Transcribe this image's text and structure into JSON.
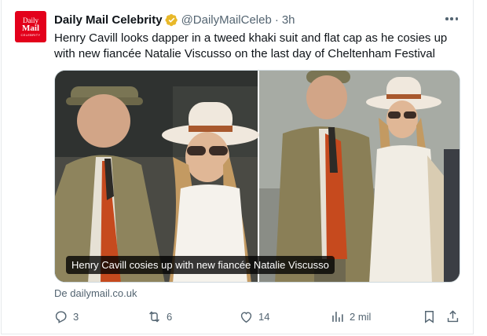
{
  "author": {
    "avatar_lines": [
      "Daily",
      "Mail",
      "CELEBRITY"
    ],
    "name": "Daily Mail Celebrity",
    "handle": "@DailyMailCeleb",
    "separator": "·",
    "time": "3h",
    "verified_color": "#E8B829"
  },
  "tweet": {
    "text": "Henry Cavill looks dapper in a tweed khaki suit and flat cap as he cosies up with new fiancée Natalie Viscusso on the last day of Cheltenham Festival"
  },
  "media": {
    "caption": "Henry Cavill cosies up with new fiancée Natalie Viscusso"
  },
  "source": "De dailymail.co.uk",
  "actions": {
    "replies": "3",
    "reposts": "6",
    "likes": "14",
    "views": "2 mil"
  },
  "icons": [
    "verified-icon",
    "more-icon",
    "reply-icon",
    "repost-icon",
    "like-icon",
    "views-icon",
    "bookmark-icon",
    "share-icon"
  ],
  "colors": {
    "avatar_bg": "#E3001B",
    "text_primary": "#0F1419",
    "text_secondary": "#536471"
  }
}
